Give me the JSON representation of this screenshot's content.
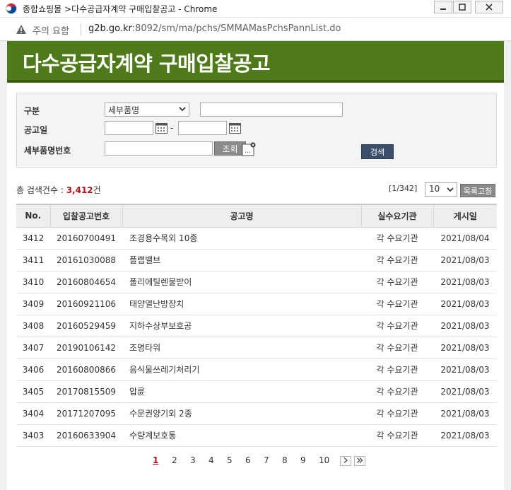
{
  "window": {
    "title": "종합쇼핑몰 >다수공급자계약 구매입찰공고 - Chrome"
  },
  "address": {
    "warning": "주의 요함",
    "url_host": "g2b.go.kr",
    "url_rest": ":8092/sm/ma/pchs/SMMAMasPchsPannList.do"
  },
  "header": {
    "title": "다수공급자계약 구매입찰공고"
  },
  "search": {
    "category_label": "구분",
    "category_value": "세부품명",
    "date_label": "공고일",
    "date_separator": "-",
    "item_no_label": "세부품명번호",
    "lookup_label": "조회",
    "search_label": "검색"
  },
  "summary": {
    "prefix": "총 검색건수 : ",
    "count": "3,412",
    "suffix": "건",
    "page_info": "[1/342]",
    "per_page": "10",
    "refresh_label": "목록고침"
  },
  "table": {
    "headers": [
      "No.",
      "입찰공고번호",
      "공고명",
      "실수요기관",
      "게시일"
    ],
    "rows": [
      [
        "3412",
        "20160700491",
        "조경용수목외 10종",
        "각 수요기관",
        "2021/08/04"
      ],
      [
        "3411",
        "20161030088",
        "플랩밸브",
        "각 수요기관",
        "2021/08/03"
      ],
      [
        "3410",
        "20160804654",
        "폴리에틸렌물받이",
        "각 수요기관",
        "2021/08/03"
      ],
      [
        "3409",
        "20160921106",
        "태양열난방장치",
        "각 수요기관",
        "2021/08/03"
      ],
      [
        "3408",
        "20160529459",
        "지하수상부보호공",
        "각 수요기관",
        "2021/08/03"
      ],
      [
        "3407",
        "20190106142",
        "조명타워",
        "각 수요기관",
        "2021/08/03"
      ],
      [
        "3406",
        "20160800866",
        "음식물쓰레기처리기",
        "각 수요기관",
        "2021/08/03"
      ],
      [
        "3405",
        "20170815509",
        "압륜",
        "각 수요기관",
        "2021/08/03"
      ],
      [
        "3404",
        "20171207095",
        "수문권양기외 2종",
        "각 수요기관",
        "2021/08/03"
      ],
      [
        "3403",
        "20160633904",
        "수량계보호통",
        "각 수요기관",
        "2021/08/03"
      ]
    ]
  },
  "pagination": {
    "pages": [
      "1",
      "2",
      "3",
      "4",
      "5",
      "6",
      "7",
      "8",
      "9",
      "10"
    ],
    "current": "1"
  },
  "colors": {
    "header_green": "#4e7a19",
    "count_red": "#b5121b",
    "search_button": "#3b4f6b"
  }
}
